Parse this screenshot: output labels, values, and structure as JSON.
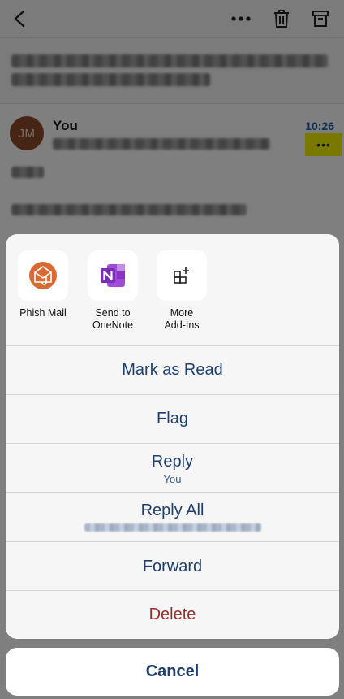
{
  "email": {
    "sender": "You",
    "avatar_initials": "JM",
    "time": "10:26",
    "more_label": "•••"
  },
  "toolbar": {
    "back_icon": "chevron-left-icon",
    "more_icon": "ellipsis-icon",
    "delete_icon": "trash-icon",
    "archive_icon": "archive-icon"
  },
  "addins": [
    {
      "label": "Phish Mail",
      "icon": "phish-mail-icon"
    },
    {
      "label": "Send to\nOneNote",
      "icon": "onenote-icon"
    },
    {
      "label": "More\nAdd-Ins",
      "icon": "add-grid-icon"
    }
  ],
  "actions": {
    "mark_read": "Mark as Read",
    "flag": "Flag",
    "reply": "Reply",
    "reply_sub": "You",
    "reply_all": "Reply All",
    "forward": "Forward",
    "delete": "Delete"
  },
  "cancel_label": "Cancel",
  "colors": {
    "accent": "#1f3f6e",
    "destructive": "#9a2b2b",
    "highlight": "#f2f200",
    "time": "#1b5fa8",
    "phish": "#d96a34",
    "onenote": "#7b2fb7"
  }
}
